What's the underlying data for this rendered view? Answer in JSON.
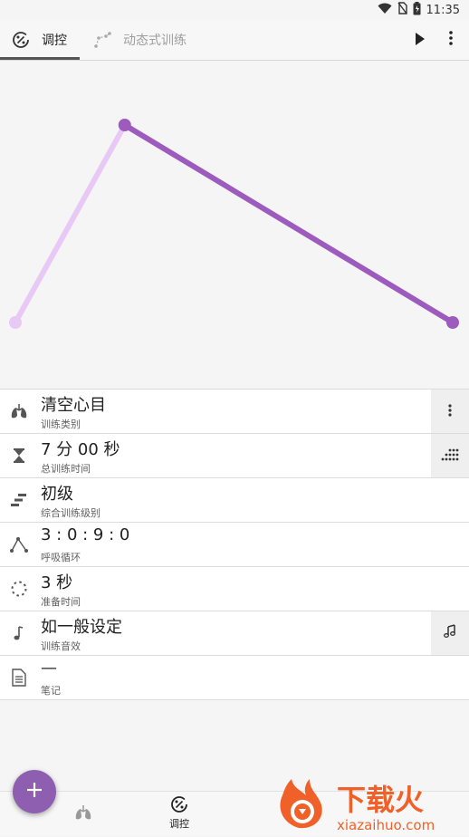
{
  "status_bar": {
    "time": "11:35"
  },
  "tabs": [
    {
      "label": "调控",
      "icon": "percent-circle-icon",
      "active": true
    },
    {
      "label": "动态式训练",
      "icon": "dotted-path-icon",
      "active": false
    }
  ],
  "toolbar": {
    "play_icon": "play-icon",
    "menu_icon": "more-vert-icon"
  },
  "chart_data": {
    "type": "line",
    "x": [
      0,
      3,
      12
    ],
    "series": [
      {
        "values": [
          0,
          1,
          0
        ],
        "color": "#9c5bbd",
        "inhale_color": "#e8c9f5"
      }
    ]
  },
  "settings": [
    {
      "value": "清空心目",
      "label": "训练类别",
      "icon": "lungs-icon",
      "side_icon": "more-vert-icon"
    },
    {
      "value": "7 分 00 秒",
      "label": "总训练时间",
      "icon": "hourglass-icon",
      "side_icon": "dots-grid-icon"
    },
    {
      "value": "初级",
      "label": "综合训练级别",
      "icon": "level-bars-icon"
    },
    {
      "value": "3 : 0 : 9 : 0",
      "label": "呼吸循环",
      "icon": "breath-cycle-icon"
    },
    {
      "value": "3 秒",
      "label": "准备时间",
      "icon": "dotted-circle-icon"
    },
    {
      "value": "如一般设定",
      "label": "训练音效",
      "icon": "music-note-icon",
      "side_icon": "music-notes-icon"
    },
    {
      "value": "—",
      "label": "笔记",
      "icon": "document-icon"
    }
  ],
  "fab": {
    "icon": "plus-icon"
  },
  "bottom_nav": [
    {
      "label": "",
      "icon": "lungs-icon"
    },
    {
      "label": "调控",
      "icon": "percent-circle-icon"
    }
  ],
  "watermark": {
    "brand": "下载火",
    "url": "xiazaihuo.com"
  }
}
